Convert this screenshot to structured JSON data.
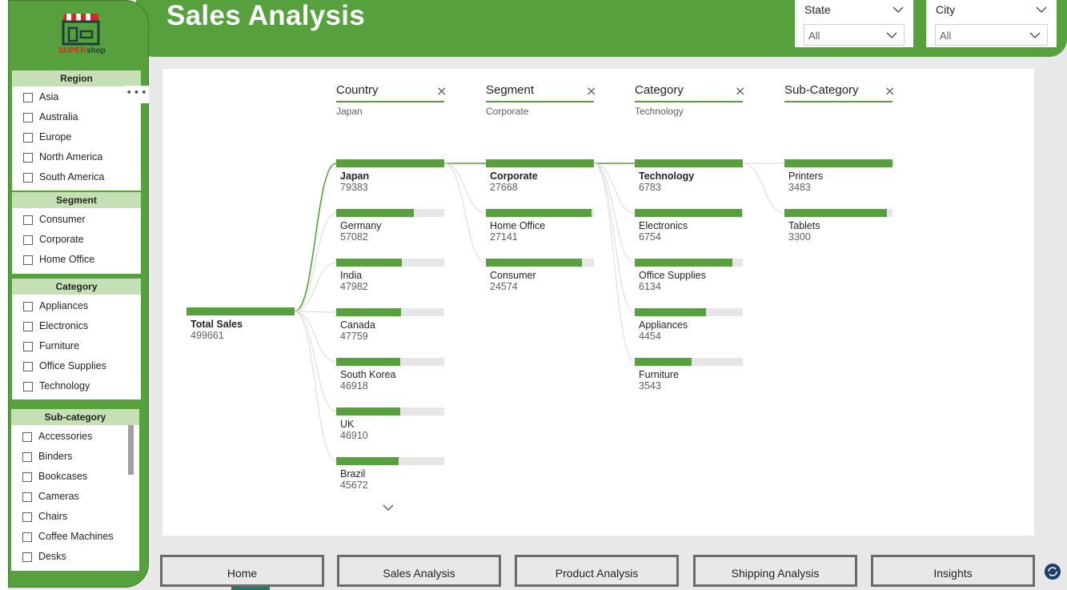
{
  "header": {
    "title": "Sales Analysis",
    "logo_text": "SUPERshop"
  },
  "filters": {
    "state": {
      "title": "State",
      "value": "All"
    },
    "city": {
      "title": "City",
      "value": "All"
    }
  },
  "sidebar": {
    "region": {
      "title": "Region",
      "items": [
        "Asia",
        "Australia",
        "Europe",
        "North America",
        "South America"
      ]
    },
    "segment": {
      "title": "Segment",
      "items": [
        "Consumer",
        "Corporate",
        "Home Office"
      ]
    },
    "category": {
      "title": "Category",
      "items": [
        "Appliances",
        "Electronics",
        "Furniture",
        "Office Supplies",
        "Technology"
      ]
    },
    "subcategory": {
      "title": "Sub-category",
      "items": [
        "Accessories",
        "Binders",
        "Bookcases",
        "Cameras",
        "Chairs",
        "Coffee Machines",
        "Desks"
      ]
    },
    "more_options": "•••"
  },
  "tree": {
    "root": {
      "name": "Total Sales",
      "value": 499661
    },
    "levels": [
      {
        "title": "Country",
        "selected": "Japan",
        "close": "×",
        "nodes": [
          {
            "name": "Japan",
            "value": 79383
          },
          {
            "name": "Germany",
            "value": 57082
          },
          {
            "name": "India",
            "value": 47982
          },
          {
            "name": "Canada",
            "value": 47759
          },
          {
            "name": "South Korea",
            "value": 46918
          },
          {
            "name": "UK",
            "value": 46910
          },
          {
            "name": "Brazil",
            "value": 45672
          }
        ]
      },
      {
        "title": "Segment",
        "selected": "Corporate",
        "close": "×",
        "nodes": [
          {
            "name": "Corporate",
            "value": 27668
          },
          {
            "name": "Home Office",
            "value": 27141
          },
          {
            "name": "Consumer",
            "value": 24574
          }
        ]
      },
      {
        "title": "Category",
        "selected": "Technology",
        "close": "×",
        "nodes": [
          {
            "name": "Technology",
            "value": 6783
          },
          {
            "name": "Electronics",
            "value": 6754
          },
          {
            "name": "Office Supplies",
            "value": 6134
          },
          {
            "name": "Appliances",
            "value": 4454
          },
          {
            "name": "Furniture",
            "value": 3543
          }
        ]
      },
      {
        "title": "Sub-Category",
        "selected": "",
        "close": "×",
        "nodes": [
          {
            "name": "Printers",
            "value": 3483
          },
          {
            "name": "Tablets",
            "value": 3300
          }
        ]
      }
    ]
  },
  "nav": {
    "buttons": [
      "Home",
      "Sales Analysis",
      "Product Analysis",
      "Shipping Analysis",
      "Insights"
    ]
  },
  "colors": {
    "accent": "#56a03d",
    "slicer_header": "#c5e0b4"
  }
}
